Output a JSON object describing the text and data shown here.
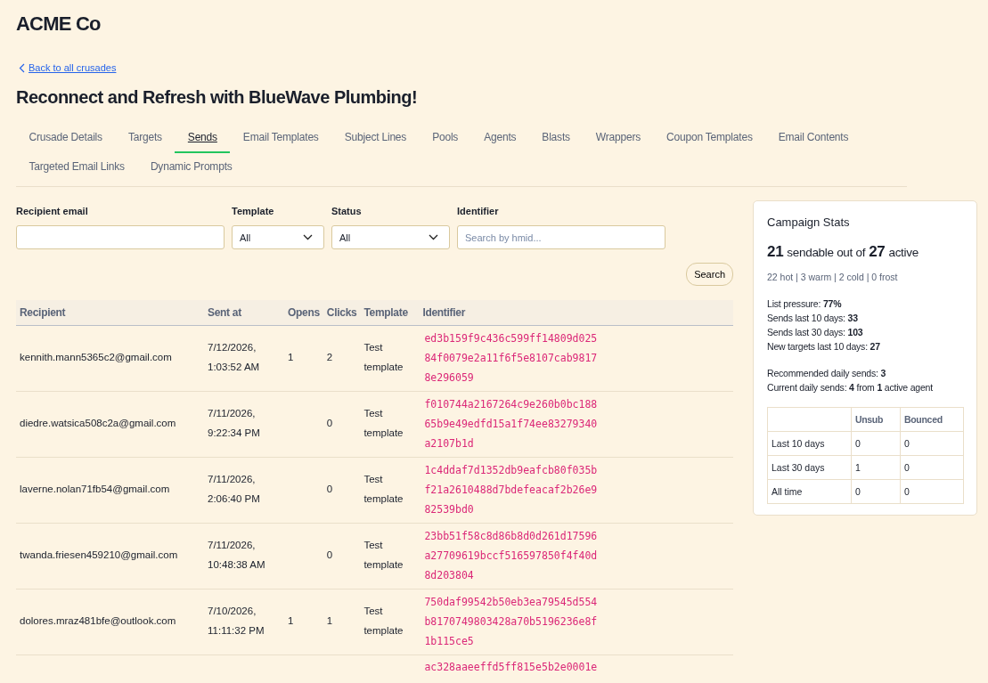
{
  "brand": "ACME Co",
  "back_link": "Back to all crusades",
  "title": "Reconnect and Refresh with BlueWave Plumbing!",
  "tabs": [
    {
      "label": "Crusade Details",
      "selected": false
    },
    {
      "label": "Targets",
      "selected": false
    },
    {
      "label": "Sends",
      "selected": true
    },
    {
      "label": "Email Templates",
      "selected": false
    },
    {
      "label": "Subject Lines",
      "selected": false
    },
    {
      "label": "Pools",
      "selected": false
    },
    {
      "label": "Agents",
      "selected": false
    },
    {
      "label": "Blasts",
      "selected": false
    },
    {
      "label": "Wrappers",
      "selected": false
    },
    {
      "label": "Coupon Templates",
      "selected": false
    },
    {
      "label": "Email Contents",
      "selected": false
    },
    {
      "label": "Targeted Email Links",
      "selected": false
    },
    {
      "label": "Dynamic Prompts",
      "selected": false
    }
  ],
  "filters": [
    {
      "kind": "text",
      "label": "Recipient email"
    },
    {
      "kind": "select",
      "label": "Template",
      "value": "All"
    },
    {
      "kind": "select",
      "label": "Status",
      "value": "All"
    },
    {
      "kind": "text",
      "label": "Identifier",
      "placeholder": "Search by hmid..."
    }
  ],
  "search_button": "Search",
  "table": {
    "columns": [
      "Recipient",
      "Sent at",
      "Opens",
      "Clicks",
      "Template",
      "Identifier"
    ],
    "rows": [
      {
        "recipient": "kennith.mann5365c2@gmail.com",
        "sent_at": "7/12/2026, 1:03:52 AM",
        "opens": "1",
        "clicks": "2",
        "template": "Test template",
        "identifier": "ed3b159f9c436c599ff14809d02584f0079e2a11f6f5e8107cab98178e296059"
      },
      {
        "recipient": "diedre.watsica508c2a@gmail.com",
        "sent_at": "7/11/2026, 9:22:34 PM",
        "clicks": "0",
        "template": "Test template",
        "identifier": "f010744a2167264c9e260b0bc18865b9e49edfd15a1f74ee83279340a2107b1d"
      },
      {
        "recipient": "laverne.nolan71fb54@gmail.com",
        "sent_at": "7/11/2026, 2:06:40 PM",
        "clicks": "0",
        "template": "Test template",
        "identifier": "1c4ddaf7d1352db9eafcb80f035bf21a2610488d7bdefeacaf2b26e982539bd0"
      },
      {
        "recipient": "twanda.friesen459210@gmail.com",
        "sent_at": "7/11/2026, 10:48:38 AM",
        "clicks": "0",
        "template": "Test template",
        "identifier": "23bb51f58c8d86b8d0d261d17596a27709619bccf516597850f4f40d8d203804"
      },
      {
        "recipient": "dolores.mraz481bfe@outlook.com",
        "sent_at": "7/10/2026, 11:11:32 PM",
        "opens": "1",
        "clicks": "1",
        "template": "Test template",
        "identifier": "750daf99542b50eb3ea79545d554b8170749803428a70b5196236e8f1b115ce5"
      },
      {
        "identifier": "ac328aaeeffd5ff815e5b2e0001e"
      }
    ]
  },
  "stats": {
    "title": "Campaign Stats",
    "sendable": "21",
    "sendable_text": "sendable out of",
    "active": "27",
    "active_text": "active",
    "temperature": "22 hot | 3 warm | 2 cold | 0 frost",
    "metrics": [
      "List pressure: **77%**",
      "Sends last 10 days: **33**",
      "Sends last 30 days: **103**",
      "New targets last 10 days: **27**"
    ],
    "daily": [
      "Recommended daily sends: **3**",
      "Current daily sends: **4** from **1** active agent"
    ],
    "table": {
      "columns": [
        "Unsub",
        "Bounced"
      ],
      "rows": [
        {
          "label": "Last 10 days",
          "unsub": "0",
          "bounced": "0"
        },
        {
          "label": "Last 30 days",
          "unsub": "1",
          "bounced": "0"
        },
        {
          "label": "All time",
          "unsub": "0",
          "bounced": "0"
        }
      ]
    }
  }
}
